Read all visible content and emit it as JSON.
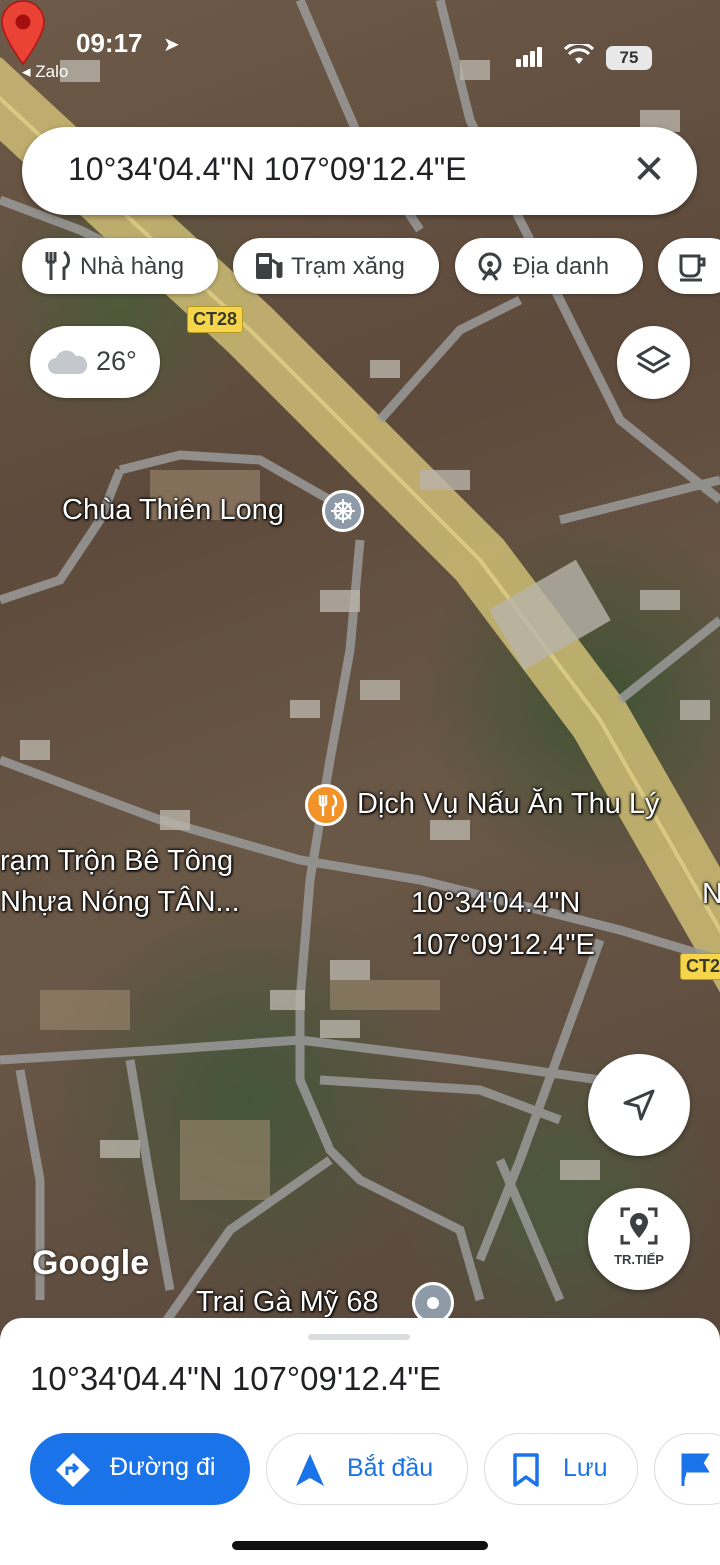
{
  "status_bar": {
    "time": "09:17",
    "back_app": "◂ Zalo",
    "battery": "75"
  },
  "search": {
    "value": "10°34'04.4\"N 107°09'12.4\"E",
    "close_glyph": "✕"
  },
  "chips": [
    {
      "label": "Nhà hàng",
      "icon": "restaurant-icon"
    },
    {
      "label": "Trạm xăng",
      "icon": "gas-station-icon"
    },
    {
      "label": "Địa danh",
      "icon": "landmark-icon"
    },
    {
      "label": "",
      "icon": "cafe-icon"
    }
  ],
  "weather": {
    "temp": "26°",
    "icon": "cloud-icon"
  },
  "map_labels": {
    "road_shield_1": "CT28",
    "road_shield_2": "CT2",
    "temple": "Chùa Thiên Long",
    "catering": "Dịch Vụ Nấu Ăn Thu Lý",
    "concrete_line1": "rạm Trộn Bê Tông",
    "concrete_line2": "Nhựa Nóng TÂN...",
    "pin_line1": "10°34'04.4\"N",
    "pin_line2": "107°09'12.4\"E",
    "edge_letter": "N",
    "farm": "Trai Gà Mỹ 68",
    "google": "Google"
  },
  "fabs": {
    "locate_icon": "navigation-arrow-icon",
    "continue_label": "TR.TIẾP"
  },
  "sheet": {
    "coordinates": "10°34'04.4\"N 107°09'12.4\"E",
    "buttons": [
      {
        "label": "Đường đi",
        "icon": "directions-icon"
      },
      {
        "label": "Bắt đầu",
        "icon": "navigation-icon"
      },
      {
        "label": "Lưu",
        "icon": "bookmark-icon"
      },
      {
        "label": "",
        "icon": "flag-icon"
      }
    ]
  },
  "colors": {
    "accent": "#1a73e8",
    "pin": "#ea4335",
    "poi_orange": "#f29227",
    "poi_blue": "#3a8fd1",
    "poi_gray": "#8e9aa8"
  }
}
